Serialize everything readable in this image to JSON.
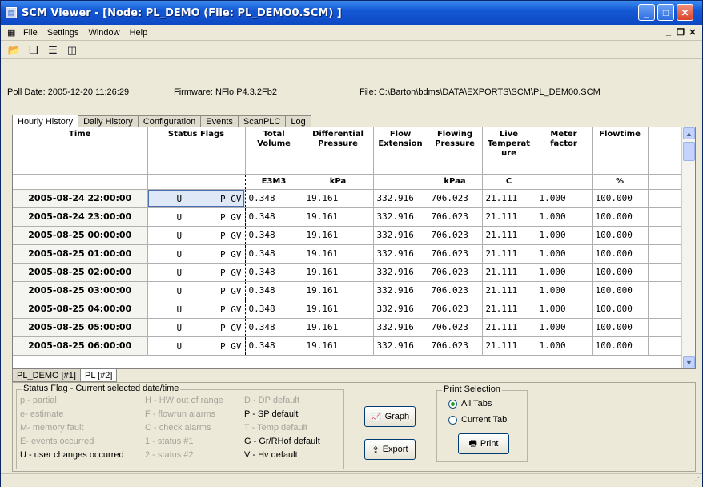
{
  "window": {
    "title": "SCM Viewer - [Node: PL_DEMO (File: PL_DEMO0.SCM) ]"
  },
  "menu": [
    "File",
    "Settings",
    "Window",
    "Help"
  ],
  "info": {
    "poll_date": "Poll Date: 2005-12-20 11:26:29",
    "firmware": "Firmware: NFlo P4.3.2Fb2",
    "file": "File: C:\\Barton\\bdms\\DATA\\EXPORTS\\SCM\\PL_DEM00.SCM"
  },
  "tabs": [
    "Hourly History",
    "Daily History",
    "Configuration",
    "Events",
    "ScanPLC",
    "Log"
  ],
  "grid": {
    "headers": [
      "Time",
      "Status Flags",
      "Total Volume",
      "Differential Pressure",
      "Flow Extension",
      "Flowing Pressure",
      "Live Temperat ure",
      "Meter factor",
      "Flowtime"
    ],
    "units": [
      "",
      "",
      "E3M3",
      "kPa",
      "",
      "kPaa",
      "C",
      "",
      "%"
    ],
    "rows": [
      {
        "time": "2005-08-24 22:00:00",
        "flag_u": "U",
        "flag_pgv": "P GV",
        "total_volume": "0.348",
        "diff_pressure": "19.161",
        "flow_ext": "332.916",
        "flowing_pressure": "706.023",
        "live_temp": "21.111",
        "meter_factor": "1.000",
        "flowtime": "100.000"
      },
      {
        "time": "2005-08-24 23:00:00",
        "flag_u": "U",
        "flag_pgv": "P GV",
        "total_volume": "0.348",
        "diff_pressure": "19.161",
        "flow_ext": "332.916",
        "flowing_pressure": "706.023",
        "live_temp": "21.111",
        "meter_factor": "1.000",
        "flowtime": "100.000"
      },
      {
        "time": "2005-08-25 00:00:00",
        "flag_u": "U",
        "flag_pgv": "P GV",
        "total_volume": "0.348",
        "diff_pressure": "19.161",
        "flow_ext": "332.916",
        "flowing_pressure": "706.023",
        "live_temp": "21.111",
        "meter_factor": "1.000",
        "flowtime": "100.000"
      },
      {
        "time": "2005-08-25 01:00:00",
        "flag_u": "U",
        "flag_pgv": "P GV",
        "total_volume": "0.348",
        "diff_pressure": "19.161",
        "flow_ext": "332.916",
        "flowing_pressure": "706.023",
        "live_temp": "21.111",
        "meter_factor": "1.000",
        "flowtime": "100.000"
      },
      {
        "time": "2005-08-25 02:00:00",
        "flag_u": "U",
        "flag_pgv": "P GV",
        "total_volume": "0.348",
        "diff_pressure": "19.161",
        "flow_ext": "332.916",
        "flowing_pressure": "706.023",
        "live_temp": "21.111",
        "meter_factor": "1.000",
        "flowtime": "100.000"
      },
      {
        "time": "2005-08-25 03:00:00",
        "flag_u": "U",
        "flag_pgv": "P GV",
        "total_volume": "0.348",
        "diff_pressure": "19.161",
        "flow_ext": "332.916",
        "flowing_pressure": "706.023",
        "live_temp": "21.111",
        "meter_factor": "1.000",
        "flowtime": "100.000"
      },
      {
        "time": "2005-08-25 04:00:00",
        "flag_u": "U",
        "flag_pgv": "P GV",
        "total_volume": "0.348",
        "diff_pressure": "19.161",
        "flow_ext": "332.916",
        "flowing_pressure": "706.023",
        "live_temp": "21.111",
        "meter_factor": "1.000",
        "flowtime": "100.000"
      },
      {
        "time": "2005-08-25 05:00:00",
        "flag_u": "U",
        "flag_pgv": "P GV",
        "total_volume": "0.348",
        "diff_pressure": "19.161",
        "flow_ext": "332.916",
        "flowing_pressure": "706.023",
        "live_temp": "21.111",
        "meter_factor": "1.000",
        "flowtime": "100.000"
      },
      {
        "time": "2005-08-25 06:00:00",
        "flag_u": "U",
        "flag_pgv": "P GV",
        "total_volume": "0.348",
        "diff_pressure": "19.161",
        "flow_ext": "332.916",
        "flowing_pressure": "706.023",
        "live_temp": "21.111",
        "meter_factor": "1.000",
        "flowtime": "100.000"
      }
    ]
  },
  "node_tabs": [
    "PL_DEMO [#1]",
    "PL [#2]"
  ],
  "legend": {
    "title": "Status Flag - Current selected date/time",
    "col1": [
      "p - partial",
      "e- estimate",
      "M- memory fault",
      "E- events occurred",
      "U - user changes occurred"
    ],
    "col2": [
      "H - HW out of range",
      "F - flowrun alarms",
      "C - check alarms",
      "1 - status #1",
      "2 - status #2"
    ],
    "col3": [
      "D - DP default",
      "P - SP default",
      "T - Temp default",
      "G - Gr/RHof default",
      "V - Hv default"
    ]
  },
  "buttons": {
    "graph": "Graph",
    "export": "Export",
    "print": "Print"
  },
  "print_selection": {
    "title": "Print Selection",
    "all_tabs": "All Tabs",
    "current_tab": "Current Tab",
    "selected": "all_tabs"
  },
  "icons": [
    "app-icon",
    "folder-open-icon",
    "cascade-icon",
    "tile-horizontal-icon",
    "tile-vertical-icon",
    "graph-icon",
    "export-icon",
    "printer-icon"
  ],
  "colors": {
    "title_bar": "#1458d6",
    "selected_cell": "#dfe8f7",
    "window_bg": "#ece9d8"
  }
}
